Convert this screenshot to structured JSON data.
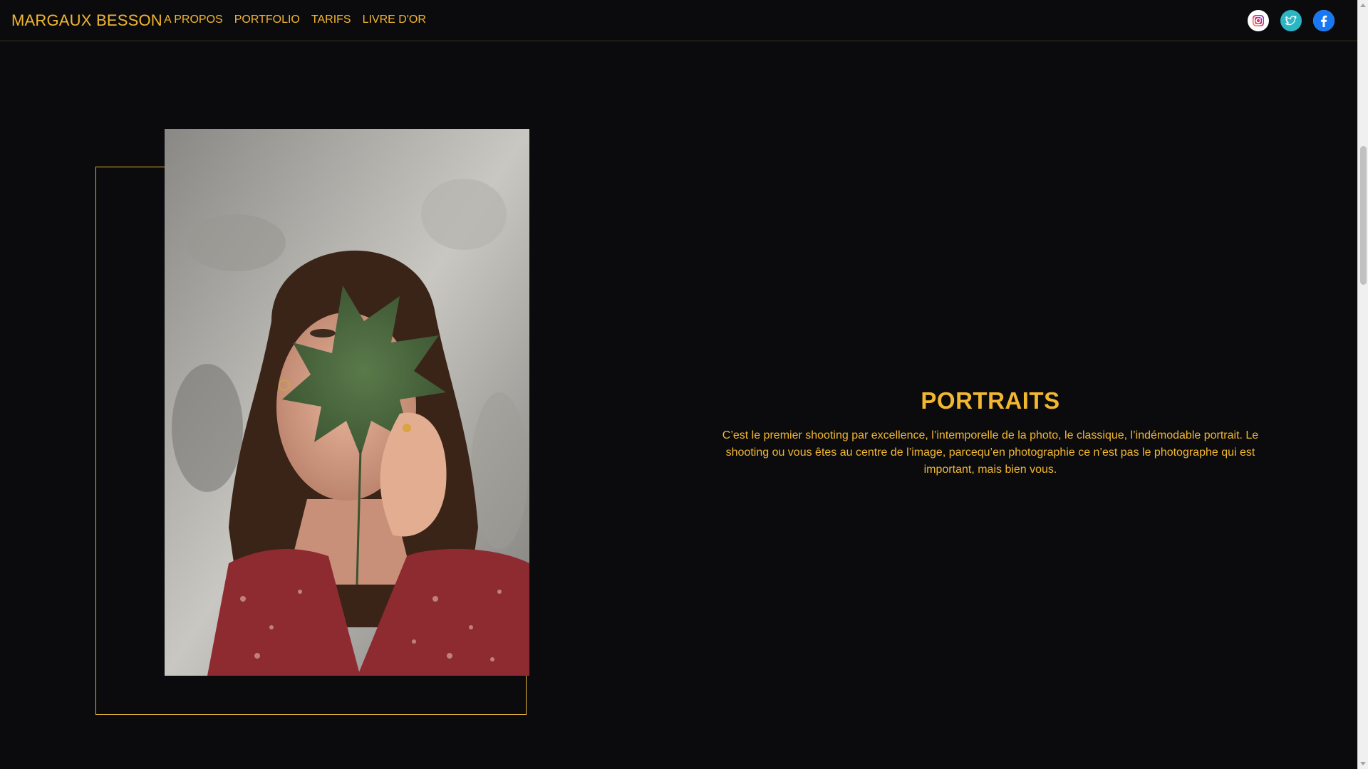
{
  "header": {
    "brand": "MARGAUX BESSON",
    "nav": [
      {
        "label": "A PROPOS"
      },
      {
        "label": "PORTFOLIO"
      },
      {
        "label": "TARIFS"
      },
      {
        "label": "LIVRE D'OR"
      }
    ],
    "socials": [
      {
        "icon": "instagram-icon"
      },
      {
        "icon": "twitter-icon"
      },
      {
        "icon": "facebook-icon"
      }
    ]
  },
  "section": {
    "title": "PORTRAITS",
    "description": "C’est le premier shooting par excellence, l’intemporelle de la photo, le classique, l’indémodable portrait. Le shooting ou vous êtes au centre de l’image, parcequ’en photographie ce n’est pas le photographe qui est important, mais bien vous."
  },
  "colors": {
    "accent": "#f2b731",
    "background": "#0b0b0e",
    "frame": "#e2b13a"
  }
}
